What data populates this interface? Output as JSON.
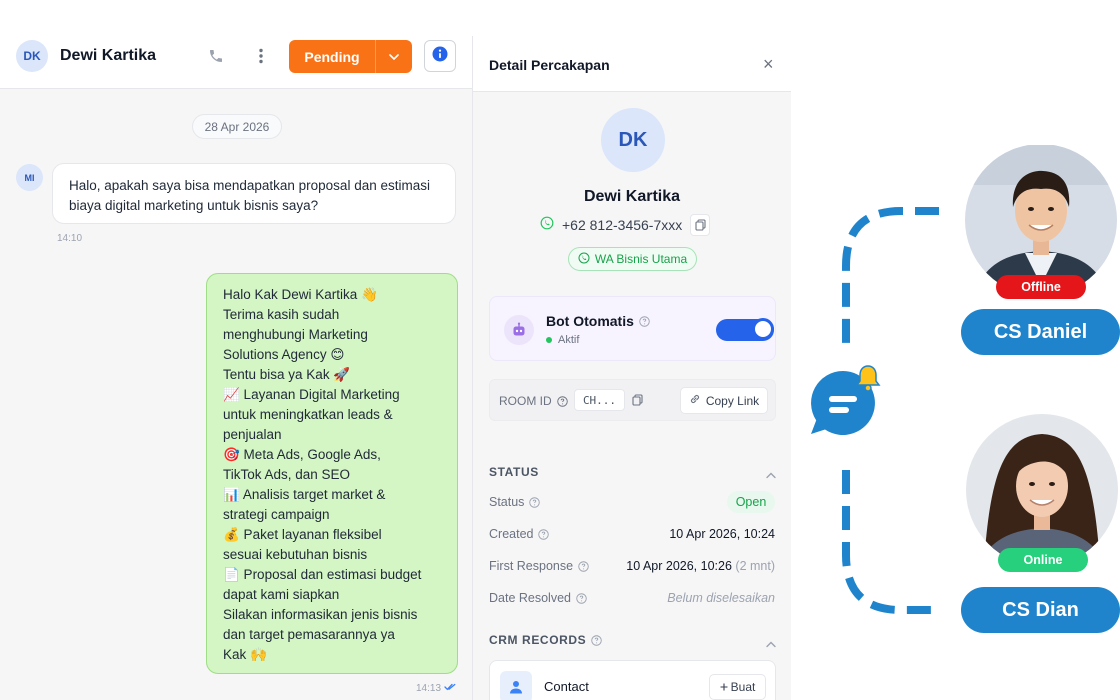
{
  "chat": {
    "contact_initials": "DK",
    "contact_name": "Dewi Kartika",
    "status_button": "Pending",
    "date_separator": "28 Apr 2026",
    "incoming": {
      "sender_initials": "MI",
      "text": "Halo, apakah saya bisa mendapatkan proposal dan estimasi biaya digital marketing untuk bisnis saya?",
      "time": "14:10"
    },
    "outgoing": {
      "lines": [
        "Halo Kak Dewi Kartika 👋",
        "Terima kasih sudah",
        "menghubungi Marketing",
        "Solutions Agency 😊",
        "Tentu bisa ya Kak 🚀",
        "📈 Layanan Digital Marketing",
        "untuk meningkatkan leads &",
        "penjualan",
        "🎯 Meta Ads, Google Ads,",
        "TikTok Ads, dan SEO",
        "📊 Analisis target market &",
        "strategi campaign",
        "💰 Paket layanan fleksibel",
        "sesuai kebutuhan bisnis",
        "📄 Proposal dan estimasi budget",
        "dapat kami siapkan",
        "Silakan informasikan jenis bisnis",
        "dan target pemasarannya ya",
        "Kak 🙌"
      ],
      "time": "14:13"
    }
  },
  "detail": {
    "title": "Detail Percakapan",
    "close_symbol": "×",
    "initials": "DK",
    "name": "Dewi Kartika",
    "phone": "+62 812-3456-7xxx",
    "channel": "WA Bisnis Utama",
    "bot": {
      "title": "Bot Otomatis",
      "status": "Aktif",
      "enabled": true
    },
    "room": {
      "label": "ROOM ID",
      "value": "CH...",
      "copy_link": "Copy Link"
    },
    "status_section": {
      "title": "STATUS",
      "rows": [
        {
          "label": "Status",
          "value": "Open"
        },
        {
          "label": "Created",
          "value": "10 Apr 2026, 10:24"
        },
        {
          "label": "First Response",
          "value": "10 Apr 2026, 10:26",
          "extra": "(2 mnt)"
        },
        {
          "label": "Date Resolved",
          "value": "Belum diselesaikan"
        }
      ]
    },
    "crm": {
      "title": "CRM RECORDS",
      "item_label": "Contact",
      "create_button": "Buat"
    }
  },
  "illustration": {
    "agents": [
      {
        "name": "CS Daniel",
        "status": "Offline",
        "status_color": "#e5161a"
      },
      {
        "name": "CS Dian",
        "status": "Online",
        "status_color": "#26d07c"
      }
    ],
    "accent_color": "#1f84cc",
    "bell_color": "#ffc21a"
  },
  "colors": {
    "pending_orange": "#f97316",
    "bubble_out_green": "#d4f5c4",
    "toggle_blue": "#2563eb",
    "avatar_bg": "#dbe6fb"
  }
}
